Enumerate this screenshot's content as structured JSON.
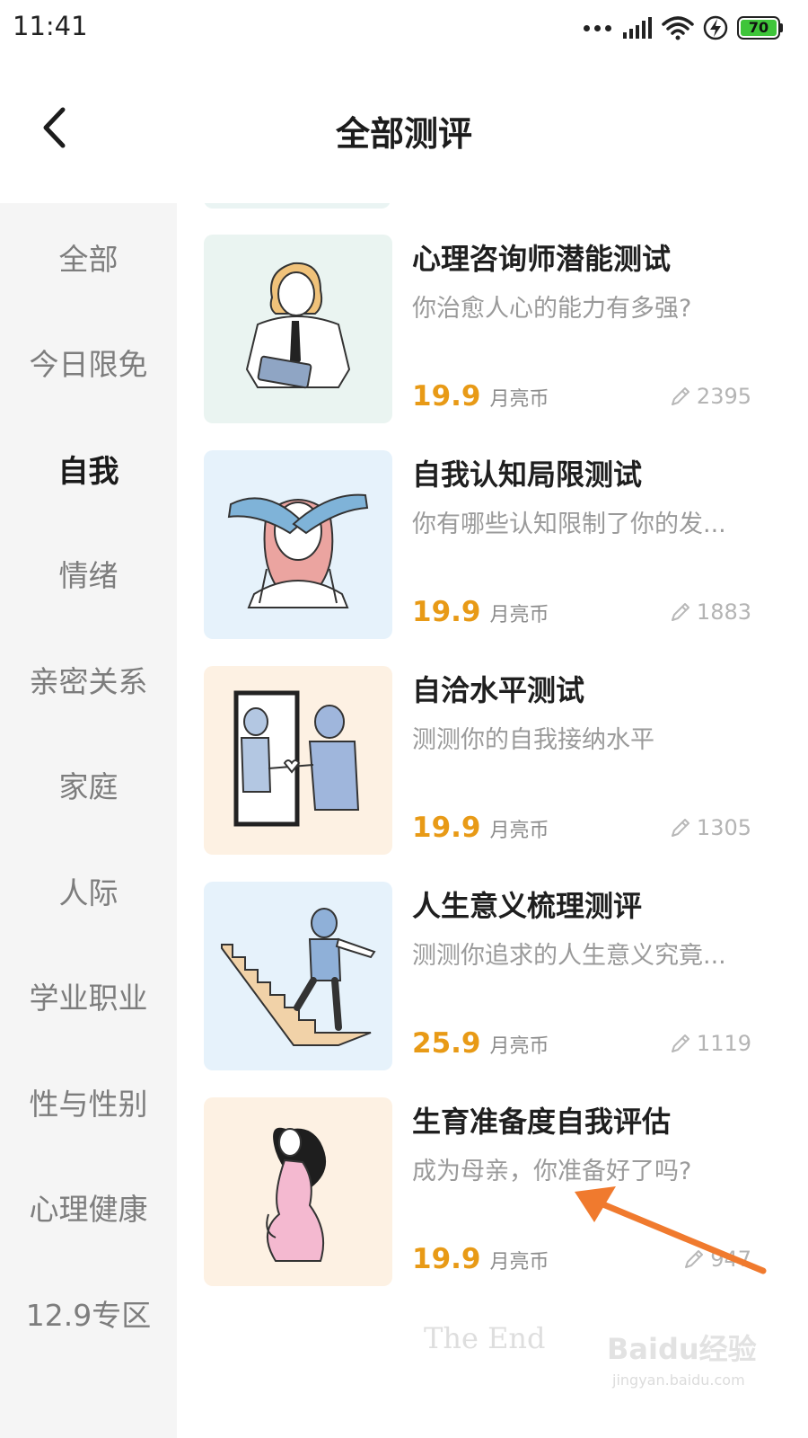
{
  "status_bar": {
    "time": "11:41",
    "battery": "70",
    "icons": [
      "dots-icon",
      "signal-icon",
      "wifi-icon",
      "charging-icon",
      "battery-icon"
    ]
  },
  "header": {
    "title": "全部测评",
    "back_icon": "chevron-left-icon"
  },
  "sidebar": {
    "active_index": 2,
    "items": [
      {
        "label": "全部"
      },
      {
        "label": "今日限免"
      },
      {
        "label": "自我"
      },
      {
        "label": "情绪"
      },
      {
        "label": "亲密关系"
      },
      {
        "label": "家庭"
      },
      {
        "label": "人际"
      },
      {
        "label": "学业职业"
      },
      {
        "label": "性与性别"
      },
      {
        "label": "心理健康"
      },
      {
        "label": "12.9专区"
      }
    ]
  },
  "cards": [
    {
      "title": "心理咨询师潜能测试",
      "desc": "你治愈人心的能力有多强?",
      "price": "19.9",
      "unit": "月亮币",
      "count": "2395",
      "thumb_bg": "#eaf4f1"
    },
    {
      "title": "自我认知局限测试",
      "desc": "你有哪些认知限制了你的发...",
      "price": "19.9",
      "unit": "月亮币",
      "count": "1883",
      "thumb_bg": "#e6f2fb"
    },
    {
      "title": "自洽水平测试",
      "desc": "测测你的自我接纳水平",
      "price": "19.9",
      "unit": "月亮币",
      "count": "1305",
      "thumb_bg": "#fdf1e3"
    },
    {
      "title": "人生意义梳理测评",
      "desc": "测测你追求的人生意义究竟...",
      "price": "25.9",
      "unit": "月亮币",
      "count": "1119",
      "thumb_bg": "#e6f2fb"
    },
    {
      "title": "生育准备度自我评估",
      "desc": "成为母亲，你准备好了吗?",
      "price": "19.9",
      "unit": "月亮币",
      "count": "947",
      "thumb_bg": "#fdf1e3"
    }
  ],
  "footer": {
    "end_text": "The End"
  },
  "watermark": {
    "main": "Baidu经验",
    "sub": "jingyan.baidu.com"
  },
  "colors": {
    "price": "#e89a16",
    "annotation_arrow": "#f07a2e",
    "sidebar_bg": "#f5f5f5"
  }
}
